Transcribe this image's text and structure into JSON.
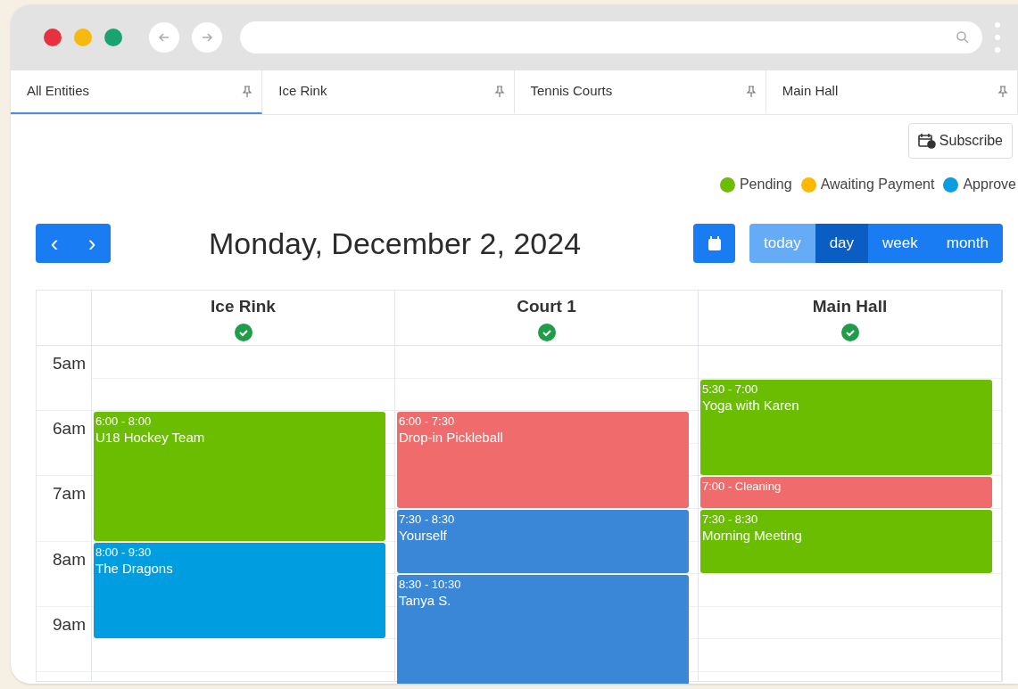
{
  "tabs": [
    {
      "label": "All Entities",
      "selected": true
    },
    {
      "label": "Ice Rink",
      "selected": false
    },
    {
      "label": "Tennis Courts",
      "selected": false
    },
    {
      "label": "Main Hall",
      "selected": false
    }
  ],
  "subscribe_button": "Subscribe",
  "legend": [
    {
      "label": "Pending",
      "color": "#6abd00"
    },
    {
      "label": "Awaiting Payment",
      "color": "#ffb800"
    },
    {
      "label": "Approve",
      "color": "#0a9de0"
    }
  ],
  "prev_button": "‹",
  "next_button": "›",
  "date_title": "Monday, December 2, 2024",
  "views": [
    {
      "label": "today",
      "selected": false,
      "kind": "today"
    },
    {
      "label": "day",
      "selected": true,
      "kind": "view"
    },
    {
      "label": "week",
      "selected": false,
      "kind": "view"
    },
    {
      "label": "month",
      "selected": false,
      "kind": "view"
    }
  ],
  "time_labels": [
    "5am",
    "6am",
    "7am",
    "8am",
    "9am"
  ],
  "columns": [
    {
      "name": "Ice Rink",
      "events": [
        {
          "time": "6:00 - 8:00",
          "title": "U18 Hockey Team",
          "color": "#6abd00"
        },
        {
          "time": "8:00 - 9:30",
          "title": "The Dragons",
          "color": "#009ee0"
        }
      ]
    },
    {
      "name": "Court 1",
      "events": [
        {
          "time": "6:00 - 7:30",
          "title": "Drop-in Pickleball",
          "color": "#f06c6c"
        },
        {
          "time": "7:30 - 8:30",
          "title": "Yourself",
          "color": "#3a87d8"
        },
        {
          "time": "8:30 - 10:30",
          "title": "Tanya S.",
          "color": "#3a87d8"
        }
      ]
    },
    {
      "name": "Main Hall",
      "events": [
        {
          "time": "5:30 - 7:00",
          "title": "Yoga with Karen",
          "color": "#6abd00"
        },
        {
          "time": "7:00 - Cleaning",
          "color": "#f06c6c"
        },
        {
          "time": "7:30 - 8:30",
          "title": "Morning Meeting",
          "color": "#6abd00"
        }
      ]
    }
  ]
}
